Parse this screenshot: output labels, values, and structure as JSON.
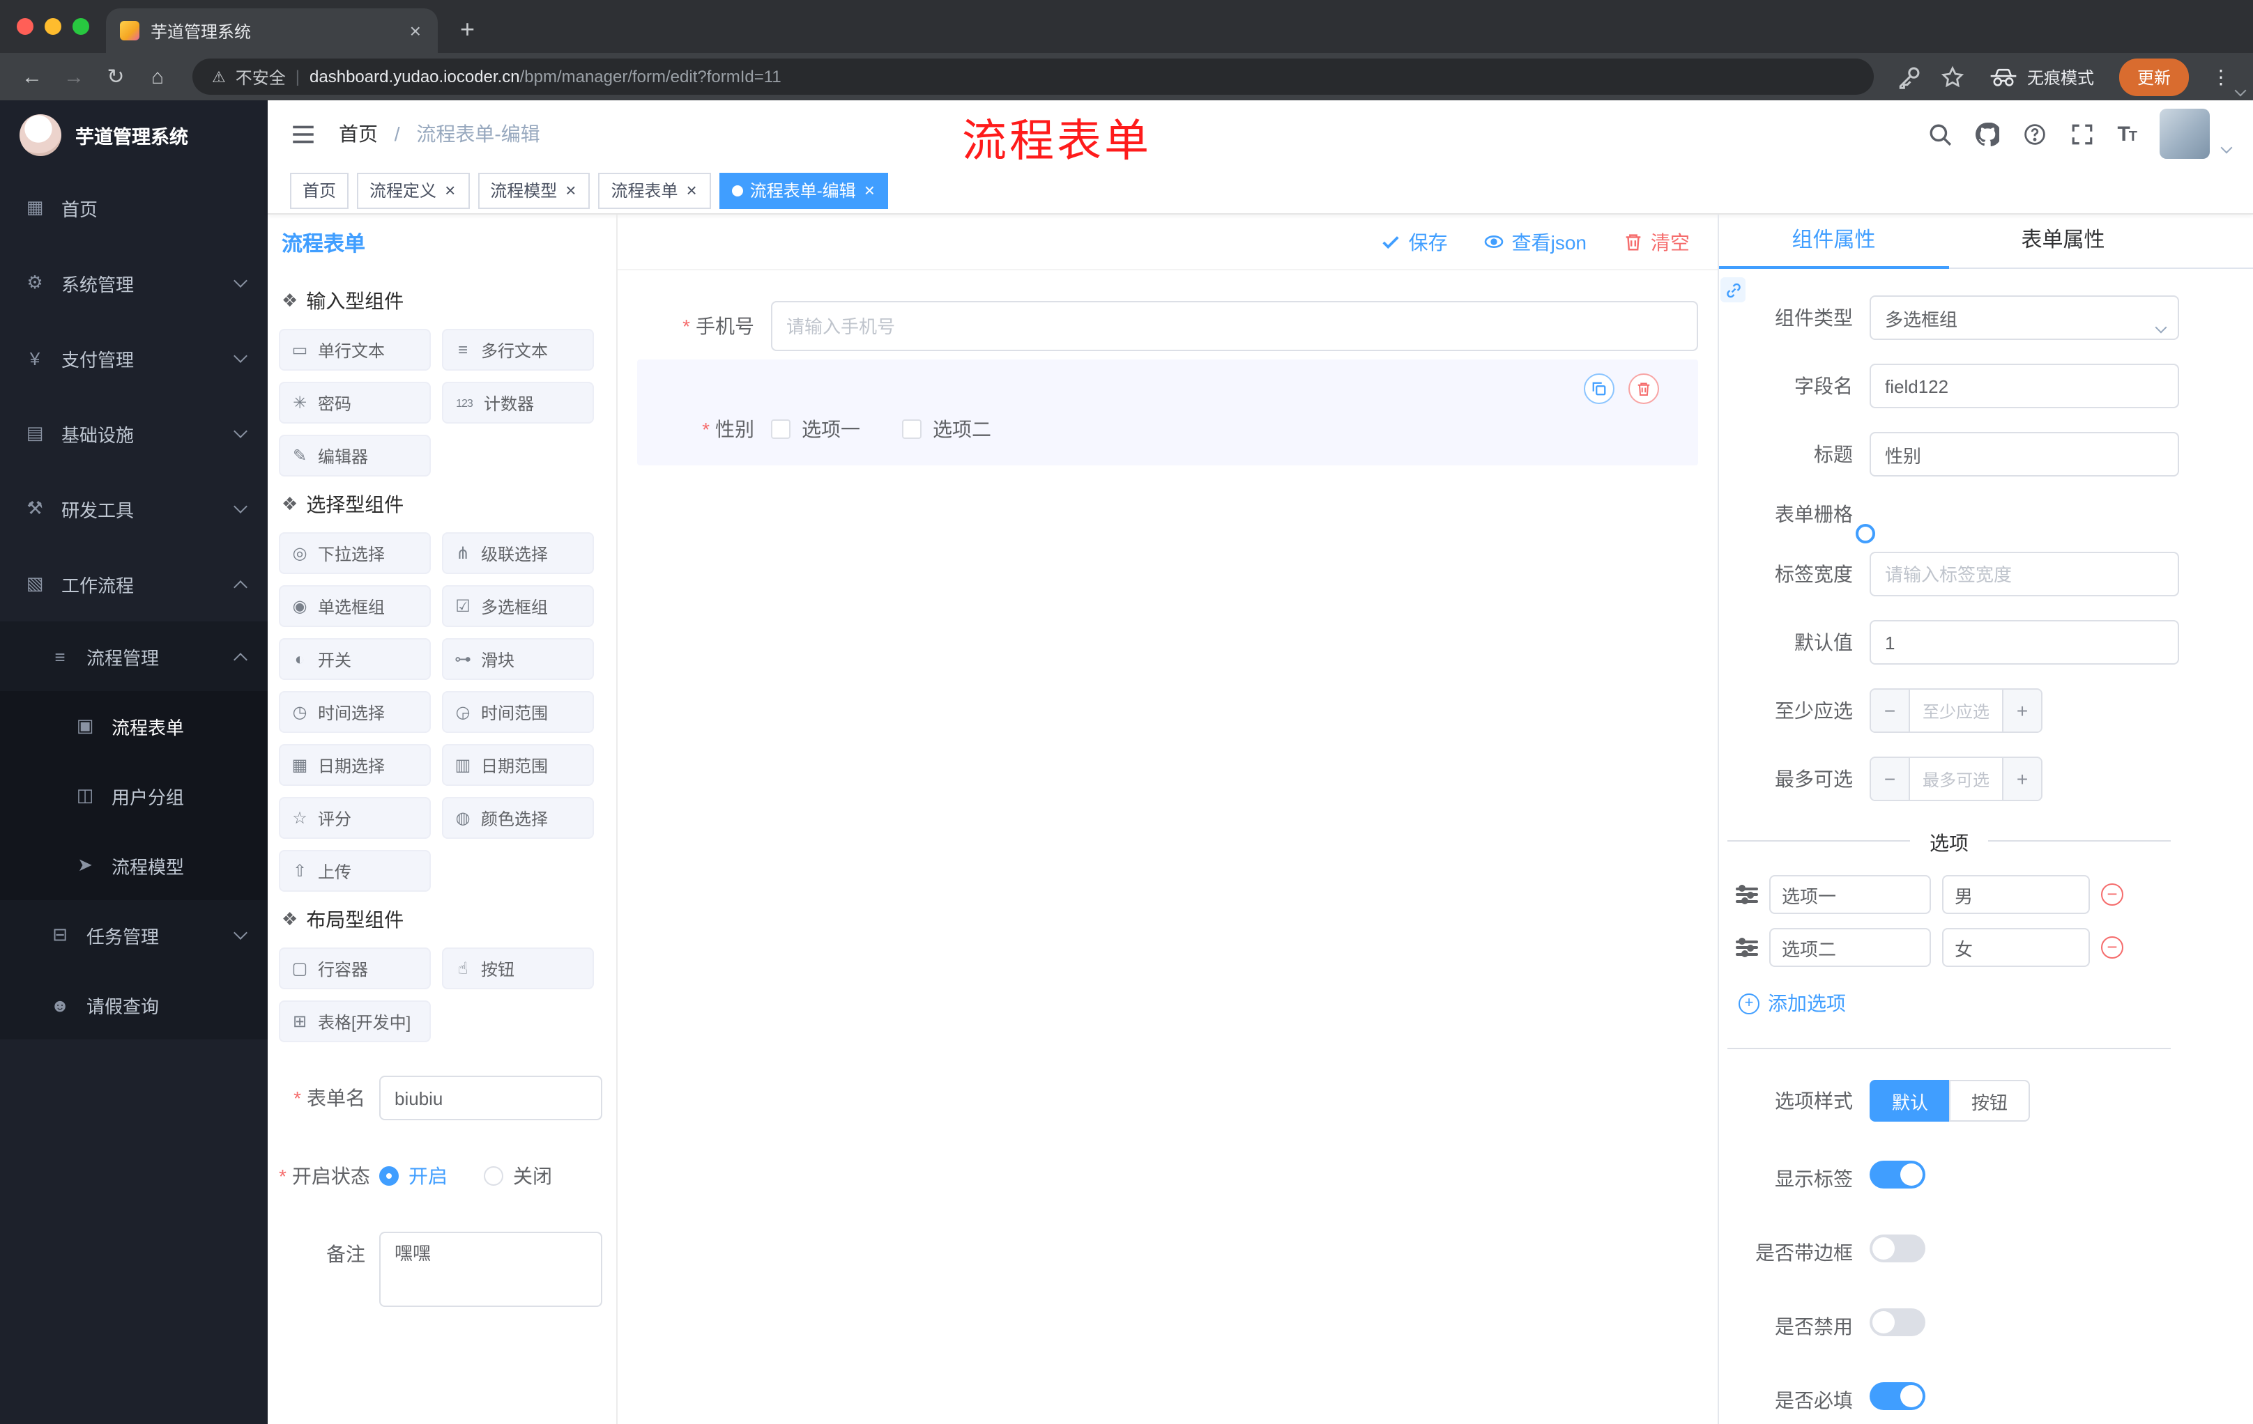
{
  "colors": {
    "accent": "#409eff",
    "danger": "#f56c6c",
    "annotation_red": "#fe1b1b"
  },
  "browser": {
    "tab_title": "芋道管理系统",
    "security_label": "不安全",
    "url_domain": "dashboard.yudao.iocoder.cn",
    "url_path": "/bpm/manager/form/edit?formId=11",
    "incognito_label": "无痕模式",
    "update_label": "更新"
  },
  "sidebar": {
    "logo_title": "芋道管理系统",
    "items": [
      {
        "label": "首页",
        "icon": "dashboard-icon",
        "level": 0
      },
      {
        "label": "系统管理",
        "icon": "gear-icon",
        "level": 0,
        "chevron": "down"
      },
      {
        "label": "支付管理",
        "icon": "yen-icon",
        "level": 0,
        "chevron": "down"
      },
      {
        "label": "基础设施",
        "icon": "infrastructure-icon",
        "level": 0,
        "chevron": "down"
      },
      {
        "label": "研发工具",
        "icon": "tools-icon",
        "level": 0,
        "chevron": "down"
      },
      {
        "label": "工作流程",
        "icon": "workflow-icon",
        "level": 0,
        "chevron": "up"
      },
      {
        "label": "流程管理",
        "icon": "process-manage-icon",
        "level": 1,
        "chevron": "up"
      },
      {
        "label": "流程表单",
        "icon": "form-icon",
        "level": 2,
        "active": true
      },
      {
        "label": "用户分组",
        "icon": "user-group-icon",
        "level": 2
      },
      {
        "label": "流程模型",
        "icon": "model-icon",
        "level": 2
      },
      {
        "label": "任务管理",
        "icon": "task-icon",
        "level": 1,
        "chevron": "down"
      },
      {
        "label": "请假查询",
        "icon": "person-icon",
        "level": 1
      }
    ]
  },
  "header": {
    "breadcrumb_home": "首页",
    "breadcrumb_current": "流程表单-编辑",
    "annotation": "流程表单"
  },
  "tags": [
    {
      "label": "首页",
      "closable": false,
      "active": false
    },
    {
      "label": "流程定义",
      "closable": true,
      "active": false
    },
    {
      "label": "流程模型",
      "closable": true,
      "active": false
    },
    {
      "label": "流程表单",
      "closable": true,
      "active": false
    },
    {
      "label": "流程表单-编辑",
      "closable": true,
      "active": true
    }
  ],
  "designer": {
    "panel_title": "流程表单",
    "toolbar": {
      "save": "保存",
      "view_json": "查看json",
      "clear": "清空"
    },
    "groups": [
      {
        "title": "输入型组件",
        "items": [
          {
            "label": "单行文本",
            "icon": "single-text-icon"
          },
          {
            "label": "多行文本",
            "icon": "multi-text-icon"
          },
          {
            "label": "密码",
            "icon": "password-icon"
          },
          {
            "label": "计数器",
            "icon": "counter-icon"
          },
          {
            "label": "编辑器",
            "icon": "editor-icon"
          }
        ]
      },
      {
        "title": "选择型组件",
        "items": [
          {
            "label": "下拉选择",
            "icon": "select-icon"
          },
          {
            "label": "级联选择",
            "icon": "cascader-icon"
          },
          {
            "label": "单选框组",
            "icon": "radio-icon"
          },
          {
            "label": "多选框组",
            "icon": "checkbox-icon"
          },
          {
            "label": "开关",
            "icon": "switch-icon"
          },
          {
            "label": "滑块",
            "icon": "slider-icon"
          },
          {
            "label": "时间选择",
            "icon": "time-icon"
          },
          {
            "label": "时间范围",
            "icon": "time-range-icon"
          },
          {
            "label": "日期选择",
            "icon": "date-icon"
          },
          {
            "label": "日期范围",
            "icon": "date-range-icon"
          },
          {
            "label": "评分",
            "icon": "rate-icon"
          },
          {
            "label": "颜色选择",
            "icon": "color-icon"
          },
          {
            "label": "上传",
            "icon": "upload-icon"
          }
        ]
      },
      {
        "title": "布局型组件",
        "items": [
          {
            "label": "行容器",
            "icon": "row-container-icon"
          },
          {
            "label": "按钮",
            "icon": "button-icon"
          },
          {
            "label": "表格[开发中]",
            "icon": "table-icon"
          }
        ]
      }
    ],
    "meta": {
      "form_name_label": "表单名",
      "form_name_value": "biubiu",
      "status_label": "开启状态",
      "status_on": "开启",
      "status_off": "关闭",
      "remark_label": "备注",
      "remark_value": "嘿嘿"
    }
  },
  "canvas": {
    "phone_label": "手机号",
    "phone_placeholder": "请输入手机号",
    "gender_label": "性别",
    "gender_options": [
      "选项一",
      "选项二"
    ]
  },
  "properties": {
    "tab_component": "组件属性",
    "tab_form": "表单属性",
    "component_type_label": "组件类型",
    "component_type_value": "多选框组",
    "field_name_label": "字段名",
    "field_name_value": "field122",
    "title_label": "标题",
    "title_value": "性别",
    "grid_label": "表单栅格",
    "label_width_label": "标签宽度",
    "label_width_placeholder": "请输入标签宽度",
    "default_label": "默认值",
    "default_value": "1",
    "min_label": "至少应选",
    "min_placeholder": "至少应选",
    "max_label": "最多可选",
    "max_placeholder": "最多可选",
    "options_title": "选项",
    "options": [
      {
        "label": "选项一",
        "value": "男"
      },
      {
        "label": "选项二",
        "value": "女"
      }
    ],
    "add_option": "添加选项",
    "style_label": "选项样式",
    "style_default": "默认",
    "style_button": "按钮",
    "switches": [
      {
        "label": "显示标签",
        "on": true
      },
      {
        "label": "是否带边框",
        "on": false
      },
      {
        "label": "是否禁用",
        "on": false
      },
      {
        "label": "是否必填",
        "on": true
      }
    ]
  }
}
